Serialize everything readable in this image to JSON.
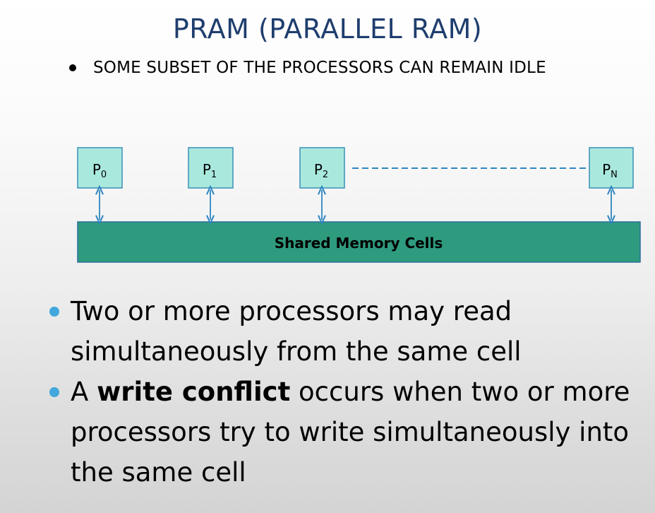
{
  "slide": {
    "title": "PRAM (PARALLEL RAM)",
    "sub_bullet": "SOME SUBSET OF THE PROCESSORS CAN REMAIN IDLE"
  },
  "diagram": {
    "processors": [
      {
        "base": "P",
        "sub": "0"
      },
      {
        "base": "P",
        "sub": "1"
      },
      {
        "base": "P",
        "sub": "2"
      },
      {
        "base": "P",
        "sub": "N"
      }
    ],
    "memory_label": "Shared Memory Cells",
    "colors": {
      "processor_fill": "#a9e9dd",
      "processor_border": "#3a8fb7",
      "memory_fill": "#2e9a7e",
      "memory_border": "#2a6f9a",
      "arrow": "#2e86c1",
      "dashed_line": "#2e86c1"
    }
  },
  "bullets": {
    "first": "Two or more processors may read simultaneously from the same cell",
    "second_prefix": "A ",
    "second_bold": "write conflict",
    "second_suffix": " occurs when two or more processors try to write simultaneously into the same cell"
  },
  "colors": {
    "title": "#1f3e6e",
    "bullet": "#42a7dc"
  }
}
